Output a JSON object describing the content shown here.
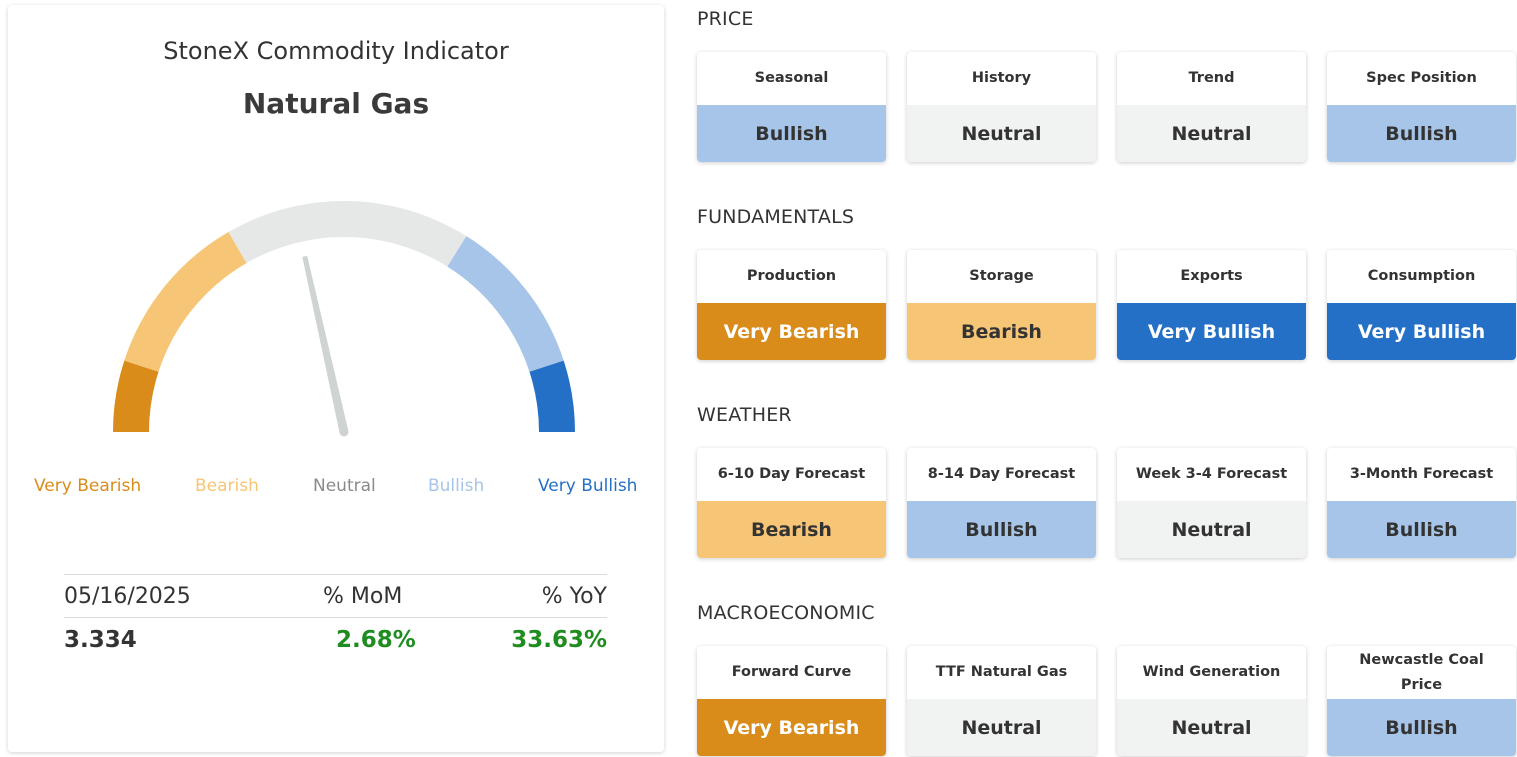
{
  "indicator": {
    "heading": "StoneX Commodity Indicator",
    "commodity": "Natural Gas",
    "needle_position": 0.43,
    "scale_labels": [
      "Very Bearish",
      "Bearish",
      "Neutral",
      "Bullish",
      "Very Bullish"
    ],
    "colors": {
      "very_bearish": "#d98c19",
      "bearish": "#f6c575",
      "neutral": "#e6e7e7",
      "bullish": "#a7c5e8",
      "very_bullish": "#2470c6",
      "needle": "#d0d3d3",
      "positive": "#1e8c1e"
    }
  },
  "stats": {
    "headers": [
      "05/16/2025",
      "% MoM",
      "% YoY"
    ],
    "values": [
      "3.334",
      "2.68%",
      "33.63%"
    ]
  },
  "sections": [
    {
      "title": "PRICE",
      "cards": [
        {
          "label": "Seasonal",
          "value": "Bullish"
        },
        {
          "label": "History",
          "value": "Neutral"
        },
        {
          "label": "Trend",
          "value": "Neutral"
        },
        {
          "label": "Spec Position",
          "value": "Bullish"
        }
      ]
    },
    {
      "title": "FUNDAMENTALS",
      "cards": [
        {
          "label": "Production",
          "value": "Very Bearish"
        },
        {
          "label": "Storage",
          "value": "Bearish"
        },
        {
          "label": "Exports",
          "value": "Very Bullish"
        },
        {
          "label": "Consumption",
          "value": "Very Bullish"
        }
      ]
    },
    {
      "title": "WEATHER",
      "cards": [
        {
          "label": "6-10 Day Forecast",
          "value": "Bearish"
        },
        {
          "label": "8-14 Day Forecast",
          "value": "Bullish"
        },
        {
          "label": "Week 3-4 Forecast",
          "value": "Neutral"
        },
        {
          "label": "3-Month Forecast",
          "value": "Bullish"
        }
      ]
    },
    {
      "title": "MACROECONOMIC",
      "cards": [
        {
          "label": "Forward Curve",
          "value": "Very Bearish"
        },
        {
          "label": "TTF Natural Gas",
          "value": "Neutral"
        },
        {
          "label": "Wind Generation",
          "value": "Neutral"
        },
        {
          "label": "Newcastle Coal Price",
          "value": "Bullish"
        }
      ]
    }
  ]
}
